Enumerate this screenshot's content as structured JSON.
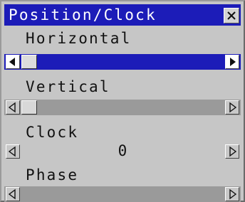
{
  "title": "Position/Clock",
  "close_icon": "close-icon",
  "rows": {
    "horizontal": {
      "label": "Horizontal",
      "selected": true,
      "level": 0.0
    },
    "vertical": {
      "label": "Vertical",
      "selected": false,
      "level": 0.0
    },
    "clock": {
      "label": "Clock",
      "value": "0"
    },
    "phase": {
      "label": "Phase",
      "selected": false
    }
  },
  "colors": {
    "title_bar": "#1c1cb8",
    "window_bg": "#c6c6c6",
    "track": "#9a9a9a",
    "selected_track": "#1c1cb8"
  }
}
